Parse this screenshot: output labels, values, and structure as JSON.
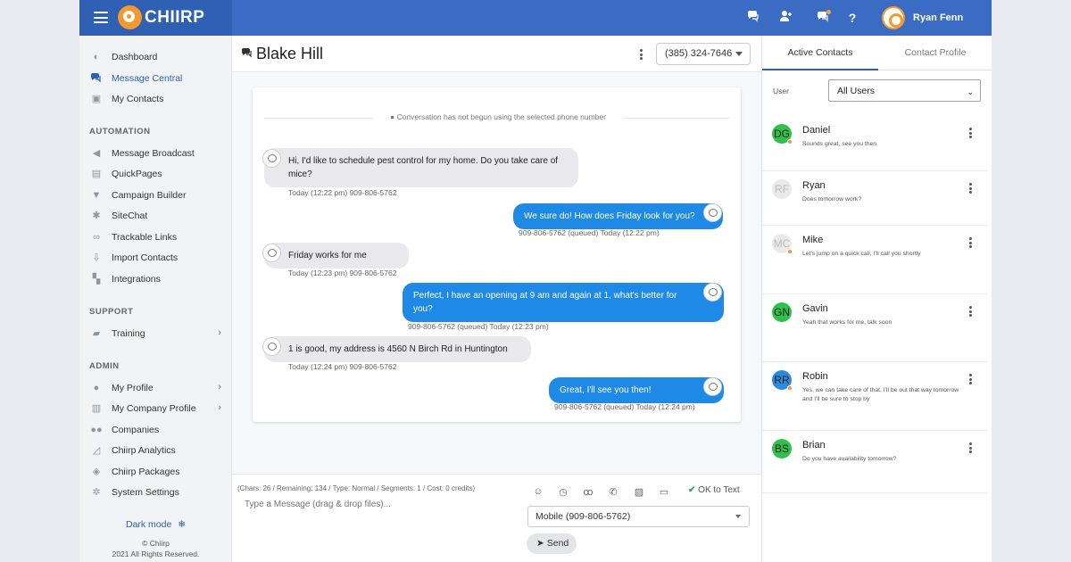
{
  "app": {
    "brand": "CHIIRP",
    "user_name": "Ryan Fenn"
  },
  "topbar": {
    "icons": [
      "chat-icon",
      "add-user-icon",
      "notifications-icon",
      "help-icon"
    ]
  },
  "sidebar": {
    "main_items": [
      {
        "label": "Dashboard",
        "icon": "dashboard-icon"
      },
      {
        "label": "Message Central",
        "icon": "chat-icon",
        "active": true
      },
      {
        "label": "My Contacts",
        "icon": "contacts-icon"
      }
    ],
    "automation_header": "AUTOMATION",
    "automation_items": [
      {
        "label": "Message Broadcast",
        "icon": "megaphone-icon"
      },
      {
        "label": "QuickPages",
        "icon": "page-icon"
      },
      {
        "label": "Campaign Builder",
        "icon": "filter-icon"
      },
      {
        "label": "SiteChat",
        "icon": "gear-icon"
      },
      {
        "label": "Trackable Links",
        "icon": "link-icon"
      },
      {
        "label": "Import Contacts",
        "icon": "import-icon"
      },
      {
        "label": "Integrations",
        "icon": "puzzle-icon"
      }
    ],
    "support_header": "SUPPORT",
    "support_items": [
      {
        "label": "Training",
        "icon": "graduation-cap-icon"
      }
    ],
    "admin_header": "ADMIN",
    "admin_items": [
      {
        "label": "My Profile",
        "icon": "user-icon"
      },
      {
        "label": "My Company Profile",
        "icon": "building-icon"
      },
      {
        "label": "Companies",
        "icon": "users-icon"
      },
      {
        "label": "Chiirp Analytics",
        "icon": "chart-icon"
      },
      {
        "label": "Chiirp Packages",
        "icon": "package-icon"
      },
      {
        "label": "System Settings",
        "icon": "settings-icon"
      }
    ],
    "dark_mode": "Dark mode",
    "copyright_line1": "© Chiirp",
    "copyright_line2": "2021 All Rights Reserved."
  },
  "chat": {
    "contact_name": "Blake Hill",
    "phone_number": "(385) 324-7646",
    "notice": "Conversation has not begun using the selected phone number",
    "messages": [
      {
        "direction": "in",
        "text": "Hi, I'd like to schedule pest control for my home. Do you take care of mice?",
        "meta": "Today (12:22 pm) 909-806-5762"
      },
      {
        "direction": "out",
        "text": "We sure do! How does Friday look for you?",
        "meta": "909-806-5762 (queued) Today (12:22 pm)"
      },
      {
        "direction": "in",
        "text": "Friday works for me",
        "meta": "Today (12:23 pm) 909-806-5762"
      },
      {
        "direction": "out",
        "text": "Perfect, I have an opening at 9 am and again at 1, what's better for you?",
        "meta": "909-806-5762 (queued) Today (12:23 pm)"
      },
      {
        "direction": "in",
        "text": "1 is good, my address is 4560 N Birch Rd in Huntington",
        "meta": "Today (12:24 pm) 909-806-5762"
      },
      {
        "direction": "out",
        "text": "Great, I'll see you then!",
        "meta": "909-806-5762 (queued) Today (12:24 pm)"
      }
    ]
  },
  "composer": {
    "chars_info": "(Chars: 26 / Remaining: 134 / Type: Normal / Segments: 1 / Cost: 0 credits)",
    "placeholder": "Type a Message (drag & drop files)...",
    "tools": [
      "emoji-icon",
      "clock-icon",
      "voicemail-icon",
      "phone-icon",
      "image-icon",
      "screen-icon"
    ],
    "ok_to_text": "OK to Text",
    "from_number": "Mobile (909-806-5762)",
    "send_label": "Send"
  },
  "right_panel": {
    "tabs": [
      "Active Contacts",
      "Contact Profile"
    ],
    "user_label": "User",
    "user_select": "All Users",
    "contacts": [
      {
        "initials": "DG",
        "name": "Daniel",
        "message": "Sounds great, see you then",
        "color": "#2fc14a",
        "status": true
      },
      {
        "initials": "RF",
        "name": "Ryan",
        "message": "Does tomorrow work?",
        "color": "#eaeaea",
        "status": false
      },
      {
        "initials": "MC",
        "name": "Mike",
        "message": "Let's jump on a quick call, I'll call you shortly",
        "color": "#eaeaea",
        "status": true
      },
      {
        "initials": "GN",
        "name": "Gavin",
        "message": "Yeah that works for me, talk soon",
        "color": "#2fc14a",
        "status": false
      },
      {
        "initials": "RR",
        "name": "Robin",
        "message": "Yes, we can take care of that, I'll be out that way tomorrow and I'll be sure to stop by",
        "color": "#2c8be0",
        "status": true
      },
      {
        "initials": "BS",
        "name": "Brian",
        "message": "Do you have availability tomorrow?",
        "color": "#2fc14a",
        "status": false
      }
    ]
  }
}
